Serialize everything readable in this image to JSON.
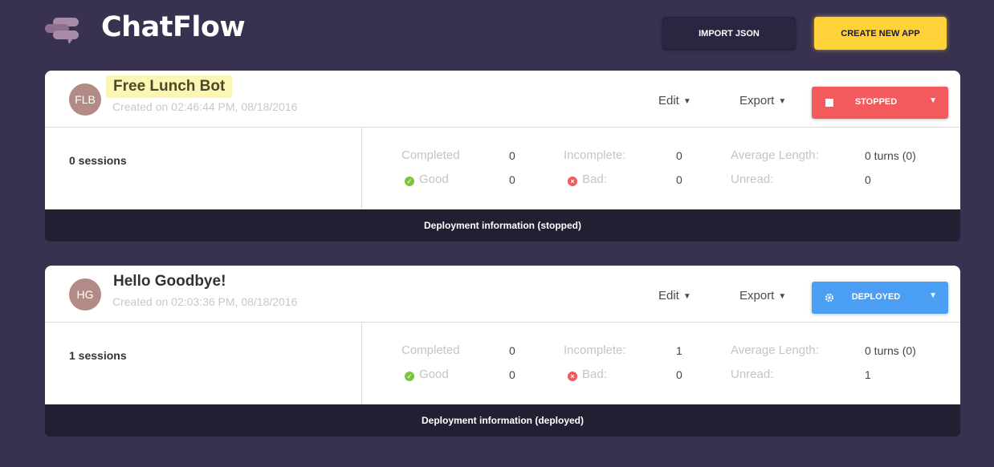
{
  "header": {
    "brand": "ChatFlow",
    "import_label": "IMPORT JSON",
    "create_label": "CREATE NEW APP"
  },
  "apps": [
    {
      "initials": "FLB",
      "name": "Free Lunch Bot",
      "created": "Created on 02:46:44 PM, 08/18/2016",
      "edit_label": "Edit",
      "export_label": "Export",
      "status_label": "STOPPED",
      "status_color": "#f4595e",
      "sessions": "0 sessions",
      "stats": {
        "completed_label": "Completed",
        "completed": "0",
        "incomplete_label": "Incomplete:",
        "incomplete": "0",
        "avg_label": "Average Length:",
        "avg": "0 turns (0)",
        "good_label": "Good",
        "good": "0",
        "bad_label": "Bad:",
        "bad": "0",
        "unread_label": "Unread:",
        "unread": "0"
      },
      "deployment_info": "Deployment information (stopped)"
    },
    {
      "initials": "HG",
      "name": "Hello Goodbye!",
      "created": "Created on 02:03:36 PM, 08/18/2016",
      "edit_label": "Edit",
      "export_label": "Export",
      "status_label": "DEPLOYED",
      "status_color": "#4a9ef4",
      "sessions": "1 sessions",
      "stats": {
        "completed_label": "Completed",
        "completed": "0",
        "incomplete_label": "Incomplete:",
        "incomplete": "1",
        "avg_label": "Average Length:",
        "avg": "0 turns (0)",
        "good_label": "Good",
        "good": "0",
        "bad_label": "Bad:",
        "bad": "0",
        "unread_label": "Unread:",
        "unread": "1"
      },
      "deployment_info": "Deployment information (deployed)"
    }
  ],
  "colors": {
    "background": "#383150",
    "accent_yellow": "#ffd23a",
    "footer": "#231f33",
    "good": "#7cc43a",
    "bad": "#f4595e"
  }
}
